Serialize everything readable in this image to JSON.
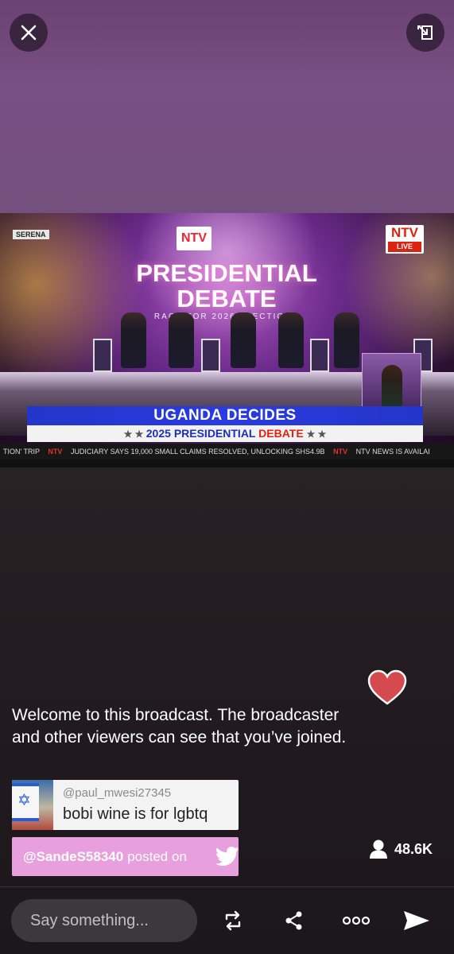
{
  "colors": {
    "background_top": "#73507e",
    "background_bottom": "#1c171a",
    "heart": "#d44a4e",
    "posted_banner": "#e79fdd",
    "comment_bg": "#f3f3f3",
    "input_bg": "#3d383b"
  },
  "top_controls": {
    "close_icon": "close-icon",
    "minimize_icon": "minimize-icon"
  },
  "video": {
    "corner_tag": "SERENA",
    "channel_logo": "NTV",
    "live_badge": "LIVE",
    "debate_title_line1": "PRESIDENTIAL",
    "debate_title_line2": "DEBATE",
    "debate_subtitle": "RACE FOR 2026 ELECTIONS",
    "lower_third_main": "UGANDA DECIDES",
    "lower_third_year": "2025",
    "lower_third_mid": "PRESIDENTIAL",
    "lower_third_end": "DEBATE",
    "ticker_items": [
      "TION' TRIP",
      "JUDICIARY SAYS 19,000 SMALL CLAIMS RESOLVED, UNLOCKING SHS4.9B",
      "NTV NEWS IS AVAILAI"
    ],
    "ticker_separator": "NTV"
  },
  "welcome_message": "Welcome to this broadcast. The broadcaster and other viewers can see that you’ve joined.",
  "comment": {
    "username": "@paul_mwesi27345",
    "text": "bobi wine is for lgbtq"
  },
  "posted_banner": {
    "handle": "@SandeS58340",
    "text": "posted on",
    "icon": "twitter-icon"
  },
  "viewers": {
    "icon": "person-icon",
    "count": "48.6K"
  },
  "bottom_bar": {
    "input_placeholder": "Say something...",
    "icons": [
      "repost-icon",
      "share-icon",
      "more-icon",
      "send-icon"
    ]
  }
}
